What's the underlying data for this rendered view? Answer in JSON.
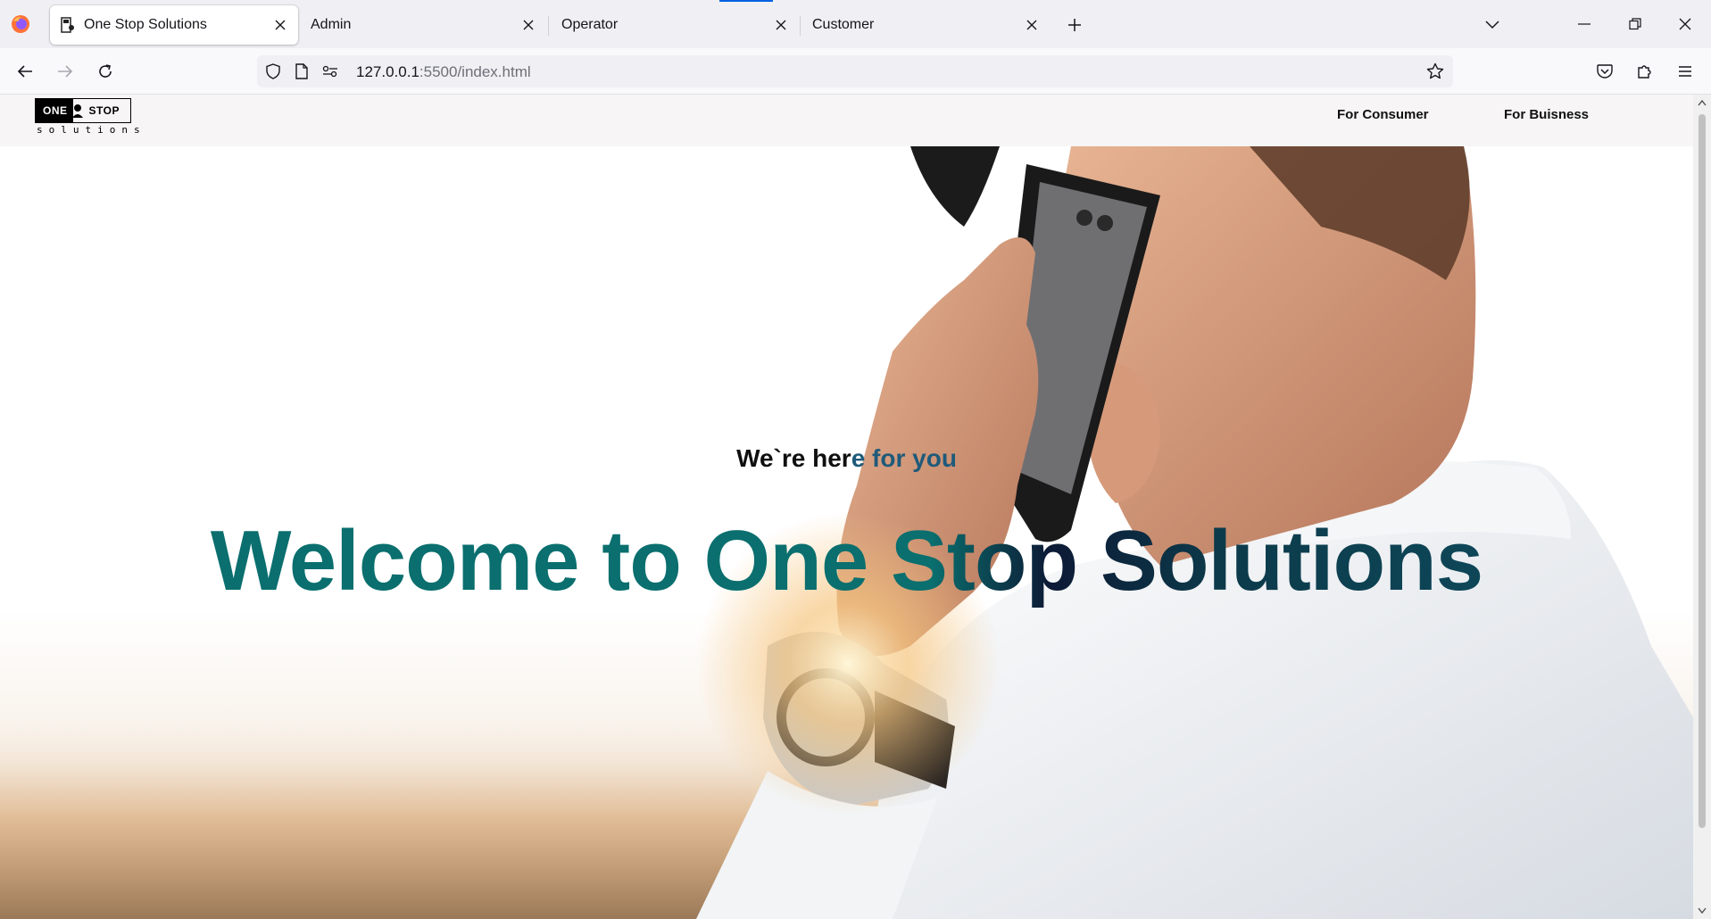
{
  "browser": {
    "tabs": [
      {
        "label": "One Stop Solutions",
        "active": true
      },
      {
        "label": "Admin",
        "active": false
      },
      {
        "label": "Operator",
        "active": false
      },
      {
        "label": "Customer",
        "active": false
      }
    ],
    "url": {
      "host": "127.0.0.1",
      "path": ":5500/index.html"
    }
  },
  "site": {
    "logo": {
      "one": "ONE",
      "stop": "STOP",
      "sub": "solutions"
    },
    "nav": [
      "For Consumer",
      "For Buisness"
    ]
  },
  "hero": {
    "tagline_main": "We`re her",
    "tagline_accent": "e for you",
    "headline": "Welcome to One Stop Solutions"
  },
  "colors": {
    "headline_teal": "#0a6f6e",
    "tagline_accent": "#1f5a7a",
    "header_bg": "#f7f5f5"
  }
}
